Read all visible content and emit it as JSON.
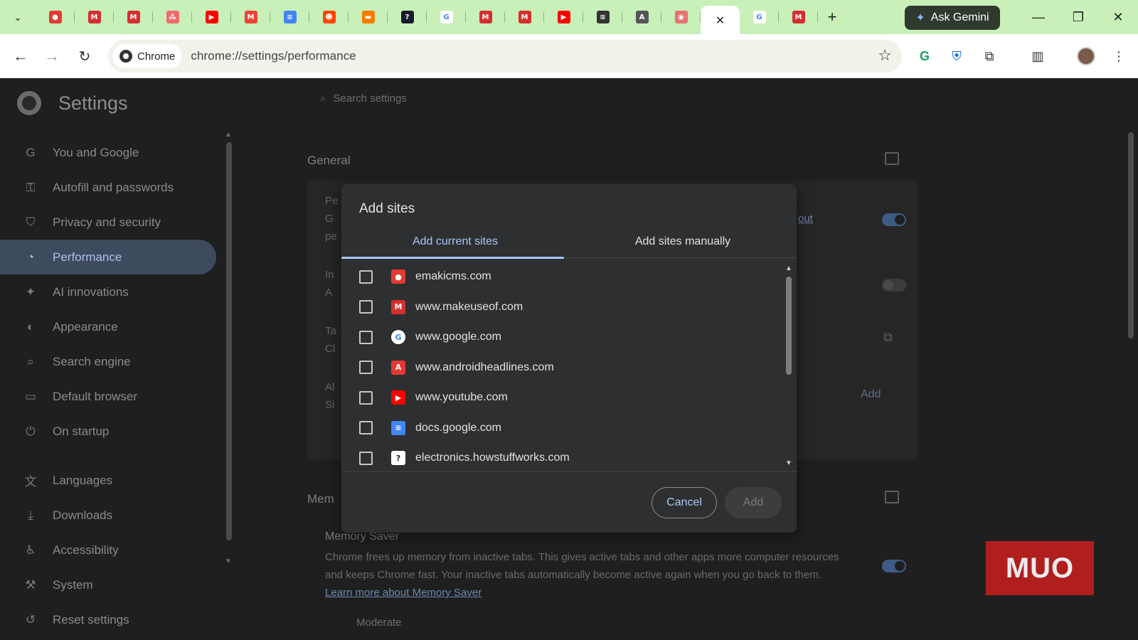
{
  "browser": {
    "tabs": [
      {
        "icon": "emakicms-favicon",
        "color": "#e53935",
        "glyph": "●"
      },
      {
        "icon": "makeuseof-favicon",
        "color": "#d32f2f",
        "glyph": "M"
      },
      {
        "icon": "makeuseof-favicon",
        "color": "#d32f2f",
        "glyph": "M"
      },
      {
        "icon": "asana-favicon",
        "color": "#f06a6a",
        "glyph": "⁂"
      },
      {
        "icon": "youtube-favicon",
        "color": "#ff0000",
        "glyph": "▶"
      },
      {
        "icon": "gmail-favicon",
        "color": "#ea4335",
        "glyph": "M"
      },
      {
        "icon": "google-docs-favicon",
        "color": "#4285f4",
        "glyph": "≡"
      },
      {
        "icon": "reddit-favicon",
        "color": "#ff4500",
        "glyph": "☻"
      },
      {
        "icon": "orange-app-favicon",
        "color": "#f57c00",
        "glyph": "▬"
      },
      {
        "icon": "howstuffworks-favicon",
        "color": "#1a1a2e",
        "glyph": "?"
      },
      {
        "icon": "google-favicon",
        "color": "#ffffff",
        "glyph": "G"
      },
      {
        "icon": "makeuseof-favicon",
        "color": "#d32f2f",
        "glyph": "M"
      },
      {
        "icon": "makeuseof-favicon",
        "color": "#d32f2f",
        "glyph": "M"
      },
      {
        "icon": "youtube-favicon",
        "color": "#ff0000",
        "glyph": "▶"
      },
      {
        "icon": "stripes-favicon",
        "color": "#333333",
        "glyph": "≋"
      },
      {
        "icon": "androidheadlines-favicon",
        "color": "#555555",
        "glyph": "A"
      },
      {
        "icon": "pink-app-favicon",
        "color": "#e57373",
        "glyph": "◉"
      },
      {
        "icon": "close-icon",
        "color": "#ffffff",
        "glyph": "✕",
        "active": true
      },
      {
        "icon": "google-favicon",
        "color": "#ffffff",
        "glyph": "G"
      },
      {
        "icon": "makeuseof-favicon",
        "color": "#d32f2f",
        "glyph": "M"
      }
    ],
    "new_tab_label": "+",
    "ask_gemini": "Ask Gemini",
    "chip_label": "Chrome",
    "url": "chrome://settings/performance"
  },
  "settings": {
    "title": "Settings",
    "search_placeholder": "Search settings",
    "nav": [
      {
        "label": "You and Google",
        "icon": "G"
      },
      {
        "label": "Autofill and passwords",
        "icon": "⚿"
      },
      {
        "label": "Privacy and security",
        "icon": "⛉"
      },
      {
        "label": "Performance",
        "icon": "◔",
        "active": true
      },
      {
        "label": "AI innovations",
        "icon": "✦"
      },
      {
        "label": "Appearance",
        "icon": "◐"
      },
      {
        "label": "Search engine",
        "icon": "⌕"
      },
      {
        "label": "Default browser",
        "icon": "▭"
      },
      {
        "label": "On startup",
        "icon": "⏻"
      },
      {
        "label": "Languages",
        "icon": "文"
      },
      {
        "label": "Downloads",
        "icon": "⤓"
      },
      {
        "label": "Accessibility",
        "icon": "♿"
      },
      {
        "label": "System",
        "icon": "⚒"
      },
      {
        "label": "Reset settings",
        "icon": "↺"
      }
    ],
    "general_heading": "General",
    "general_fragments": {
      "a": "Pe",
      "b": "G",
      "c": "pe",
      "d": "In",
      "e": "A",
      "f": "Ta",
      "g": "Cl",
      "h": "Al",
      "i": "Si",
      "link_tail": "out",
      "add_label": "Add"
    },
    "memory_heading": "Mem",
    "memory_saver_title": "Memory Saver",
    "memory_saver_desc": "Chrome frees up memory from inactive tabs. This gives active tabs and other apps more computer resources and keeps Chrome fast. Your inactive tabs automatically become active again when you go back to them.",
    "memory_saver_link": "Learn more about Memory Saver",
    "moderate_label": "Moderate"
  },
  "dialog": {
    "title": "Add sites",
    "tab_current": "Add current sites",
    "tab_manual": "Add sites manually",
    "sites": [
      {
        "domain": "emakicms.com",
        "icon": "emakicms-favicon",
        "color": "#e53935",
        "glyph": "●"
      },
      {
        "domain": "www.makeuseof.com",
        "icon": "makeuseof-favicon",
        "color": "#d32f2f",
        "glyph": "M"
      },
      {
        "domain": "www.google.com",
        "icon": "google-favicon",
        "color": "#ffffff",
        "glyph": "G"
      },
      {
        "domain": "www.androidheadlines.com",
        "icon": "androidheadlines-favicon",
        "color": "#e53935",
        "glyph": "A"
      },
      {
        "domain": "www.youtube.com",
        "icon": "youtube-favicon",
        "color": "#ff0000",
        "glyph": "▶"
      },
      {
        "domain": "docs.google.com",
        "icon": "google-docs-favicon",
        "color": "#4285f4",
        "glyph": "≡"
      },
      {
        "domain": "electronics.howstuffworks.com",
        "icon": "howstuffworks-favicon",
        "color": "#1a1a2e",
        "glyph": "?"
      }
    ],
    "cancel_label": "Cancel",
    "add_label": "Add"
  },
  "watermark": "MUO"
}
